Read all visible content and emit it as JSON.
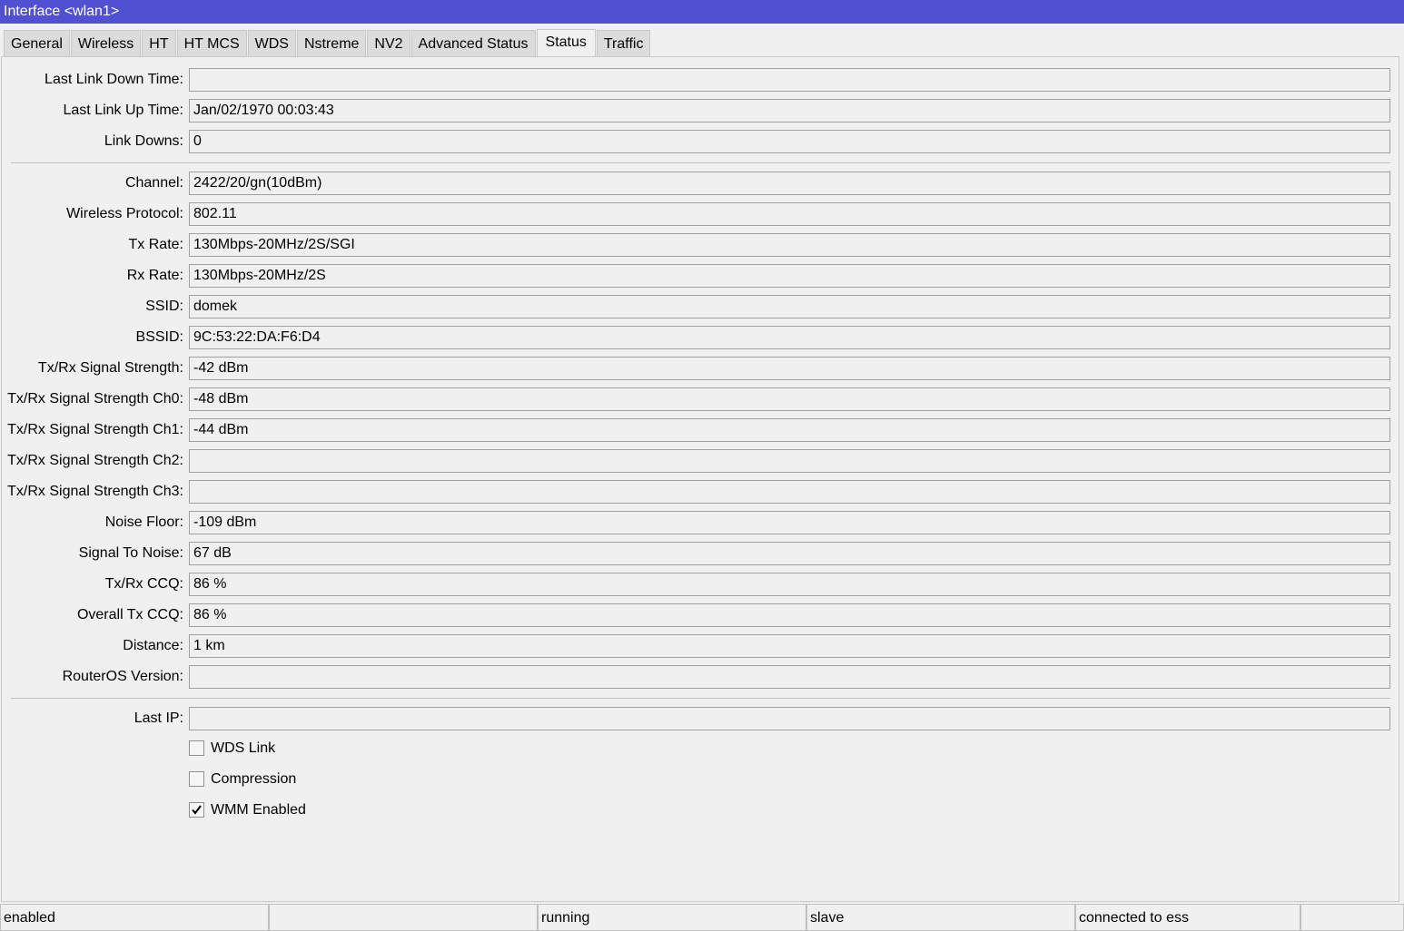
{
  "window": {
    "title": "Interface <wlan1>"
  },
  "tabs": [
    {
      "label": "General"
    },
    {
      "label": "Wireless"
    },
    {
      "label": "HT"
    },
    {
      "label": "HT MCS"
    },
    {
      "label": "WDS"
    },
    {
      "label": "Nstreme"
    },
    {
      "label": "NV2"
    },
    {
      "label": "Advanced Status"
    },
    {
      "label": "Status"
    },
    {
      "label": "Traffic"
    }
  ],
  "active_tab": "Status",
  "fields": {
    "last_link_down_time": {
      "label": "Last Link Down Time:",
      "value": ""
    },
    "last_link_up_time": {
      "label": "Last Link Up Time:",
      "value": "Jan/02/1970 00:03:43"
    },
    "link_downs": {
      "label": "Link Downs:",
      "value": "0"
    },
    "channel": {
      "label": "Channel:",
      "value": "2422/20/gn(10dBm)"
    },
    "wireless_protocol": {
      "label": "Wireless Protocol:",
      "value": "802.11"
    },
    "tx_rate": {
      "label": "Tx Rate:",
      "value": "130Mbps-20MHz/2S/SGI"
    },
    "rx_rate": {
      "label": "Rx Rate:",
      "value": "130Mbps-20MHz/2S"
    },
    "ssid": {
      "label": "SSID:",
      "value": "domek"
    },
    "bssid": {
      "label": "BSSID:",
      "value": "9C:53:22:DA:F6:D4"
    },
    "signal_strength": {
      "label": "Tx/Rx Signal Strength:",
      "value": "-42 dBm"
    },
    "signal_strength_ch0": {
      "label": "Tx/Rx Signal Strength Ch0:",
      "value": "-48 dBm"
    },
    "signal_strength_ch1": {
      "label": "Tx/Rx Signal Strength Ch1:",
      "value": "-44 dBm"
    },
    "signal_strength_ch2": {
      "label": "Tx/Rx Signal Strength Ch2:",
      "value": ""
    },
    "signal_strength_ch3": {
      "label": "Tx/Rx Signal Strength Ch3:",
      "value": ""
    },
    "noise_floor": {
      "label": "Noise Floor:",
      "value": "-109 dBm"
    },
    "signal_to_noise": {
      "label": "Signal To Noise:",
      "value": "67 dB"
    },
    "txrx_ccq": {
      "label": "Tx/Rx CCQ:",
      "value": "86 %"
    },
    "overall_tx_ccq": {
      "label": "Overall Tx CCQ:",
      "value": "86 %"
    },
    "distance": {
      "label": "Distance:",
      "value": "1 km"
    },
    "routeros_version": {
      "label": "RouterOS Version:",
      "value": ""
    },
    "last_ip": {
      "label": "Last IP:",
      "value": ""
    }
  },
  "checkboxes": {
    "wds_link": {
      "label": "WDS Link",
      "checked": false
    },
    "compression": {
      "label": "Compression",
      "checked": false
    },
    "wmm_enabled": {
      "label": "WMM Enabled",
      "checked": true
    }
  },
  "statusbar": {
    "cell1": "enabled",
    "cell2": "",
    "cell3": "running",
    "cell4": "slave",
    "cell5": "connected to ess",
    "cell6": ""
  },
  "colors": {
    "titlebar": "#5050d0",
    "background": "#f0f0f0"
  }
}
